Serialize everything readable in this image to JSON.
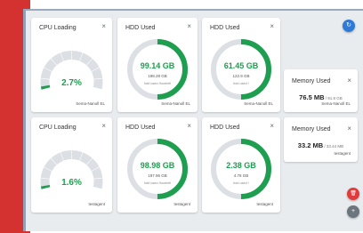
{
  "colors": {
    "accent_red": "#d43131",
    "gauge_green": "#1e9e4f",
    "gauge_track": "#dcdfe3",
    "fab_blue": "#2f7ad6",
    "fab_red": "#e23b3b",
    "fab_gray": "#6c757d"
  },
  "icons": {
    "close": "×",
    "refresh": "↻",
    "delete": "🗑",
    "add": "+"
  },
  "cards": [
    {
      "title": "CPU Loading",
      "value": "2.7%",
      "host": "Sema-Nanoll EL",
      "level": 0.027
    },
    {
      "title": "HDD Used",
      "value": "99.14 GB",
      "total": "198.28 GB",
      "sub": "hdd used /boot/efi",
      "host": "Sema-Nanoll EL",
      "level": 0.5
    },
    {
      "title": "HDD Used",
      "value": "61.45 GB",
      "total": "122.9 GB",
      "sub": "hdd used /",
      "host": "Sema-Nanoll EL",
      "level": 0.5
    },
    {
      "title": "Memory Used",
      "value": "76.5 MB",
      "total": "/ 91.8 GB",
      "host": "Sema-Nanoll EL"
    },
    {
      "title": "CPU Loading",
      "value": "1.6%",
      "host": "testagent",
      "level": 0.016
    },
    {
      "title": "HDD Used",
      "value": "98.98 GB",
      "total": "197.96 GB",
      "sub": "hdd used /boot/efi",
      "host": "testagent",
      "level": 0.5
    },
    {
      "title": "HDD Used",
      "value": "2.38 GB",
      "total": "4.76 GB",
      "sub": "hdd used /",
      "host": "testagent",
      "level": 0.5
    },
    {
      "title": "Memory Used",
      "value": "33.2 MB",
      "total": "/ 33.44 MB",
      "host": "testagent"
    }
  ]
}
